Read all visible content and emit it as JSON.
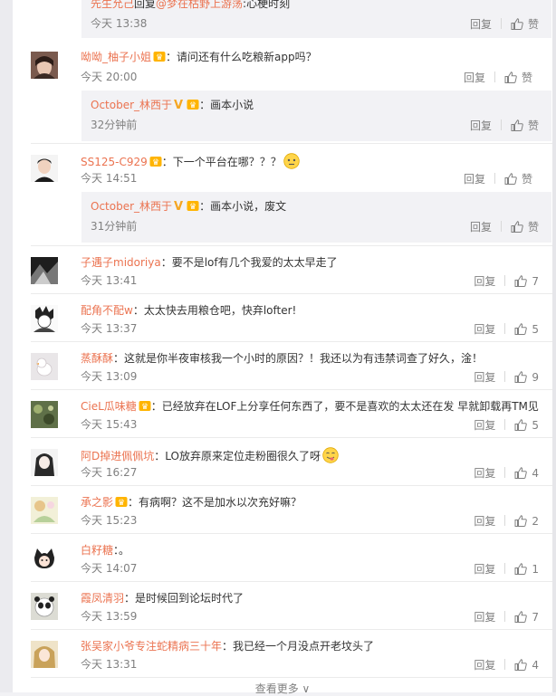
{
  "top_snippet": {
    "name": "先生允己",
    "reply_word": "回复",
    "mention": "@梦在枯野上游荡",
    "text": ":心梗时刻",
    "time": "今天 13:38"
  },
  "labels": {
    "reply": "回复",
    "like": "赞",
    "more": "查看更多 ∨"
  },
  "comments": [
    {
      "name": "呦呦_柚子小姐",
      "text": "：请问还有什么吃粮新app吗？",
      "time": "今天 20:00",
      "replies": [
        {
          "name": "October_林西于",
          "text": "：画本小说",
          "time": "32分钟前"
        }
      ]
    },
    {
      "name": "SS125-C929",
      "text": "：下一个平台在哪？？？",
      "time": "今天 14:51",
      "replies": [
        {
          "name": "October_林西于",
          "text": "：画本小说，废文",
          "time": "31分钟前"
        }
      ]
    },
    {
      "name": "子遇子midoriya",
      "text": "：要不是lof有几个我爱的太太早走了",
      "time": "今天 13:41",
      "likes": "7"
    },
    {
      "name": "配角不配w",
      "text": "：太太快去用粮仓吧，快弃lofter!",
      "time": "今天 13:37",
      "likes": "5"
    },
    {
      "name": "蒸酥酥",
      "text": "：这就是你半夜审核我一个小时的原因？！我还以为有违禁词查了好久，淦！",
      "time": "今天 13:09",
      "likes": "9"
    },
    {
      "name": "CieL瓜味糖",
      "text": "：已经放弃在LOF上分享任何东西了，要不是喜欢的太太还在发 早就卸载再TM见",
      "time": "今天 15:43",
      "likes": "5"
    },
    {
      "name": "阿D掉进佩佩坑",
      "text": "：LO放弃原来定位走粉圈很久了呀",
      "time": "今天 16:27",
      "likes": "4"
    },
    {
      "name": "承之影",
      "text": "：有病啊？这不是加水以次充好嘛？",
      "time": "今天 15:23",
      "likes": "2"
    },
    {
      "name": "白籽糖",
      "text": "：。",
      "time": "今天 14:07",
      "likes": "1"
    },
    {
      "name": "霞凤清羽",
      "text": "：是时候回到论坛时代了",
      "time": "今天 13:59",
      "likes": "7"
    },
    {
      "name": "张吴家小爷专注蛇精病三十年",
      "text": "：我已经一个月没点开老坟头了",
      "time": "今天 13:31",
      "likes": "4"
    }
  ],
  "colors": {
    "name": "#eb7350",
    "muted": "#808080",
    "sub_bg": "#f2f2f5"
  }
}
